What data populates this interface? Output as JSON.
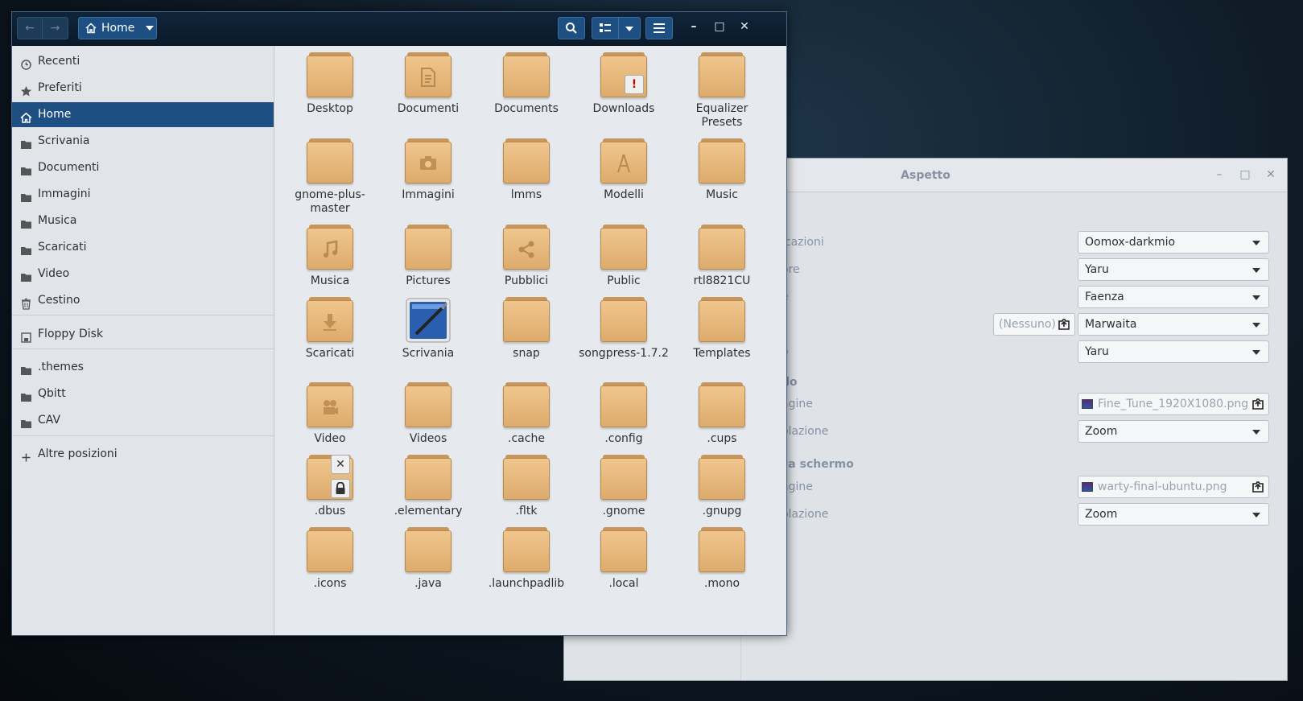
{
  "aspetto": {
    "title": "Aspetto",
    "rows": [
      {
        "label": "icazioni",
        "value": "Oomox-darkmio"
      },
      {
        "label": "ore",
        "value": "Yaru"
      },
      {
        "label": "e",
        "value": "Faenza"
      },
      {
        "label": "",
        "value": "Marwaita",
        "none_label": "(Nessuno)"
      },
      {
        "label": "o",
        "value": "Yaru"
      }
    ],
    "section1": "do",
    "bg_image_label": "agine",
    "bg_image_value": "Fine_Tune_1920X1080.png",
    "bg_adjust_label": "olazione",
    "bg_adjust_value": "Zoom",
    "section2": "ca schermo",
    "lock_image_label": "agine",
    "lock_image_value": "warty-final-ubuntu.png",
    "lock_adjust_label": "olazione",
    "lock_adjust_value": "Zoom",
    "top_partial": "i"
  },
  "files": {
    "path_label": "Home",
    "sidebar": [
      {
        "label": "Recenti",
        "icon": "clock-icon"
      },
      {
        "label": "Preferiti",
        "icon": "star-icon"
      },
      {
        "label": "Home",
        "icon": "home-icon",
        "active": true
      },
      {
        "label": "Scrivania",
        "icon": "folder-icon"
      },
      {
        "label": "Documenti",
        "icon": "folder-icon"
      },
      {
        "label": "Immagini",
        "icon": "folder-icon"
      },
      {
        "label": "Musica",
        "icon": "folder-icon"
      },
      {
        "label": "Scaricati",
        "icon": "folder-icon"
      },
      {
        "label": "Video",
        "icon": "folder-icon"
      },
      {
        "label": "Cestino",
        "icon": "trash-icon"
      },
      {
        "label": "Floppy Disk",
        "icon": "floppy-icon"
      },
      {
        "label": ".themes",
        "icon": "folder-icon"
      },
      {
        "label": "Qbitt",
        "icon": "folder-icon"
      },
      {
        "label": "CAV",
        "icon": "folder-icon"
      },
      {
        "label": "Altre posizioni",
        "icon": "plus-icon"
      }
    ],
    "items": [
      {
        "label": "Desktop",
        "emb": ""
      },
      {
        "label": "Documenti",
        "emb": "doc"
      },
      {
        "label": "Documents",
        "emb": ""
      },
      {
        "label": "Downloads",
        "emb": "warn"
      },
      {
        "label": "Equalizer Presets",
        "emb": ""
      },
      {
        "label": "gnome-plus-master",
        "emb": ""
      },
      {
        "label": "Immagini",
        "emb": "camera"
      },
      {
        "label": "lmms",
        "emb": ""
      },
      {
        "label": "Modelli",
        "emb": "compass"
      },
      {
        "label": "Music",
        "emb": ""
      },
      {
        "label": "Musica",
        "emb": "note"
      },
      {
        "label": "Pictures",
        "emb": ""
      },
      {
        "label": "Pubblici",
        "emb": "share"
      },
      {
        "label": "Public",
        "emb": ""
      },
      {
        "label": "rtl8821CU",
        "emb": ""
      },
      {
        "label": "Scaricati",
        "emb": "down"
      },
      {
        "label": "Scrivania",
        "emb": "desk"
      },
      {
        "label": "snap",
        "emb": ""
      },
      {
        "label": "songpress-1.7.2",
        "emb": ""
      },
      {
        "label": "Templates",
        "emb": ""
      },
      {
        "label": "Video",
        "emb": "film"
      },
      {
        "label": "Videos",
        "emb": ""
      },
      {
        "label": ".cache",
        "emb": ""
      },
      {
        "label": ".config",
        "emb": ""
      },
      {
        "label": ".cups",
        "emb": ""
      },
      {
        "label": ".dbus",
        "emb": "locked"
      },
      {
        "label": ".elementary",
        "emb": ""
      },
      {
        "label": ".fltk",
        "emb": ""
      },
      {
        "label": ".gnome",
        "emb": ""
      },
      {
        "label": ".gnupg",
        "emb": ""
      },
      {
        "label": ".icons",
        "emb": ""
      },
      {
        "label": ".java",
        "emb": ""
      },
      {
        "label": ".launchpadlib",
        "emb": ""
      },
      {
        "label": ".local",
        "emb": ""
      },
      {
        "label": ".mono",
        "emb": ""
      }
    ]
  }
}
